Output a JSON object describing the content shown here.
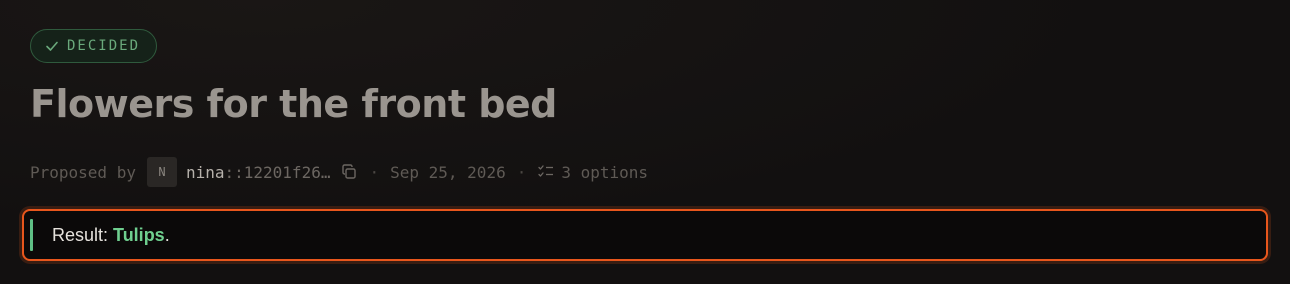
{
  "status": {
    "label": "DECIDED",
    "icon": "check-icon",
    "color": "#6aa97c"
  },
  "title": "Flowers for the front bed",
  "meta": {
    "proposed_by_label": "Proposed by",
    "avatar_initial": "N",
    "user_name": "nina",
    "user_id": "::12201f26…",
    "separator": "·",
    "date": "Sep 25, 2026",
    "options_count": "3 options"
  },
  "result": {
    "prefix": "Result: ",
    "value": "Tulips",
    "suffix": ".",
    "accent": "#6fcf8f",
    "border": "#e8561c"
  }
}
